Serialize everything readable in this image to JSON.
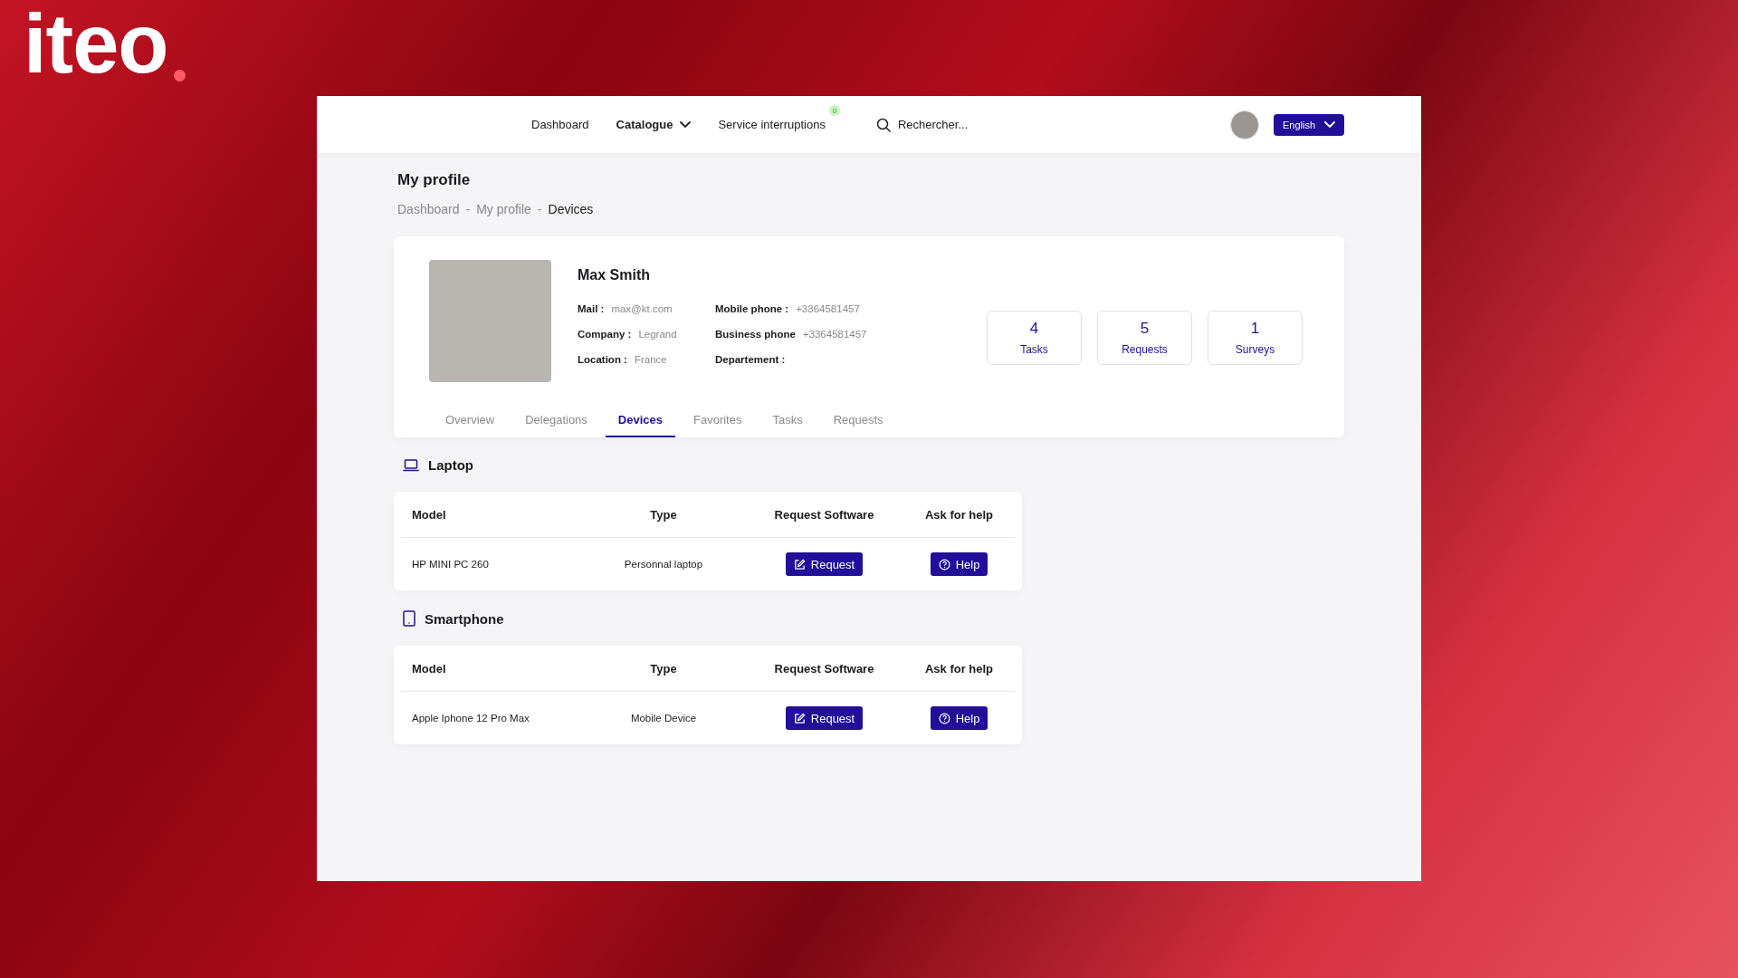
{
  "logo": {
    "text": "iteo"
  },
  "nav": {
    "items": [
      {
        "label": "Dashboard",
        "kind": "link",
        "selected": false
      },
      {
        "label": "Catalogue",
        "kind": "dropdown",
        "selected": true
      },
      {
        "label": "Service interruptions",
        "kind": "badge",
        "badge": "0",
        "selected": false
      }
    ],
    "search": {
      "placeholder": "Rechercher..."
    },
    "language": "English"
  },
  "page": {
    "title": "My profile",
    "separator": "-",
    "breadcrumb": [
      {
        "label": "Dashboard",
        "current": false
      },
      {
        "label": "My profile",
        "current": false
      },
      {
        "label": "Devices",
        "current": true
      }
    ]
  },
  "profile": {
    "name": "Max Smith",
    "fields": [
      [
        {
          "label": "Mail :",
          "value": "max@kt.com"
        },
        {
          "label": "Company :",
          "value": "Legrand"
        },
        {
          "label": "Location :",
          "value": "France"
        }
      ],
      [
        {
          "label": "Mobile phone :",
          "value": "+3364581457"
        },
        {
          "label": "Business phone",
          "value": "+3364581457"
        },
        {
          "label": "Departement :"
        }
      ]
    ],
    "stats": [
      {
        "count": "4",
        "label": "Tasks"
      },
      {
        "count": "5",
        "label": "Requests"
      },
      {
        "count": "1",
        "label": "Surveys"
      }
    ],
    "tabs": [
      {
        "label": "Overview",
        "selected": false
      },
      {
        "label": "Delegations",
        "selected": false
      },
      {
        "label": "Devices",
        "selected": true
      },
      {
        "label": "Favorites",
        "selected": false
      },
      {
        "label": "Tasks",
        "selected": false
      },
      {
        "label": "Requests",
        "selected": false
      }
    ]
  },
  "devices": [
    {
      "kind": "laptop",
      "title": "Laptop",
      "columns": [
        "Model",
        "Type",
        "Request Software",
        "Ask for help"
      ],
      "rows": [
        {
          "model": "HP MINI PC 260",
          "type": "Personnal laptop",
          "request": "Request",
          "help": "Help"
        }
      ]
    },
    {
      "kind": "smartphone",
      "title": "Smartphone",
      "columns": [
        "Model",
        "Type",
        "Request Software",
        "Ask for help"
      ],
      "rows": [
        {
          "model": "Apple Iphone 12 Pro Max",
          "type": "Mobile Device",
          "request": "Request",
          "help": "Help"
        }
      ]
    }
  ]
}
